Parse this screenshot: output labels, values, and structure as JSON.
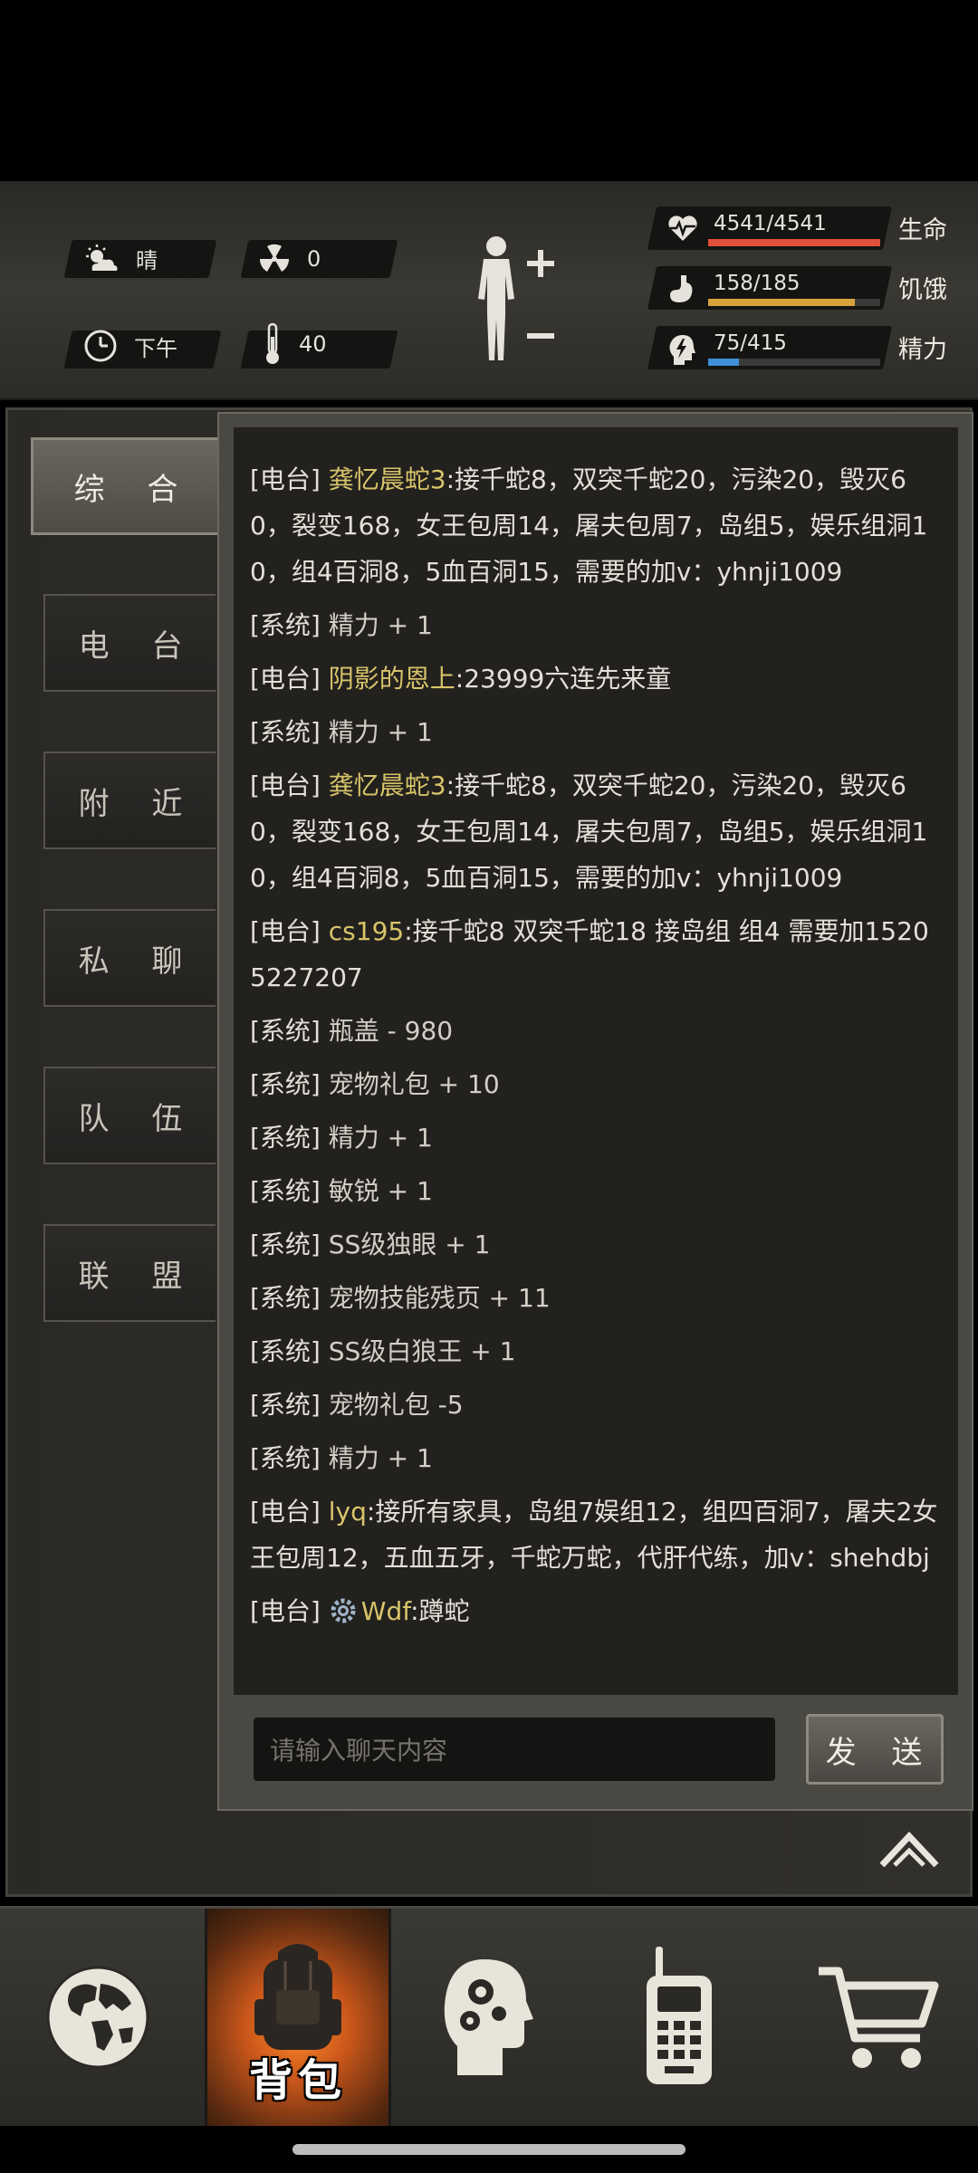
{
  "hud": {
    "weather": "晴",
    "radiation": "0",
    "time_of_day": "下午",
    "temperature": "40",
    "stats": [
      {
        "key": "health",
        "value": "4541/4541",
        "label": "生命",
        "fill": 1.0,
        "color": "#e0503a",
        "icon": "heart-pulse-icon"
      },
      {
        "key": "hunger",
        "value": "158/185",
        "label": "饥饿",
        "fill": 0.854,
        "color": "#d7a33a",
        "icon": "stomach-icon"
      },
      {
        "key": "energy",
        "value": "75/415",
        "label": "精力",
        "fill": 0.181,
        "color": "#3f8fd6",
        "icon": "head-bolt-icon"
      }
    ]
  },
  "tabs": [
    "综 合",
    "电 台",
    "附 近",
    "私 聊",
    "队 伍",
    "联 盟"
  ],
  "active_tab": 0,
  "messages": [
    {
      "channel": "[电台]",
      "sender": "龚忆晨蛇3",
      "text": ":接千蛇8，双突千蛇20，污染20，毁灭60，裂变168，女王包周14，屠夫包周7，岛组5，娱乐组洞10，组4百洞8，5血百洞15，需要的加v：yhnji1009"
    },
    {
      "channel": "[系统]",
      "sender": "",
      "text": "精力 + 1"
    },
    {
      "channel": "[电台]",
      "sender": "阴影的恩上",
      "text": ":23999六连先来童"
    },
    {
      "channel": "[系统]",
      "sender": "",
      "text": "精力 + 1"
    },
    {
      "channel": "[电台]",
      "sender": "龚忆晨蛇3",
      "text": ":接千蛇8，双突千蛇20，污染20，毁灭60，裂变168，女王包周14，屠夫包周7，岛组5，娱乐组洞10，组4百洞8，5血百洞15，需要的加v：yhnji1009"
    },
    {
      "channel": "[电台]",
      "sender": "cs195",
      "text": ":接千蛇8 双突千蛇18 接岛组 组4 需要加15205227207"
    },
    {
      "channel": "[系统]",
      "sender": "",
      "text": "瓶盖 - 980"
    },
    {
      "channel": "[系统]",
      "sender": "",
      "text": "宠物礼包 + 10"
    },
    {
      "channel": "[系统]",
      "sender": "",
      "text": "精力 + 1"
    },
    {
      "channel": "[系统]",
      "sender": "",
      "text": "敏锐 + 1"
    },
    {
      "channel": "[系统]",
      "sender": "",
      "text": "SS级独眼 + 1"
    },
    {
      "channel": "[系统]",
      "sender": "",
      "text": "宠物技能残页 + 11"
    },
    {
      "channel": "[系统]",
      "sender": "",
      "text": "SS级白狼王 + 1"
    },
    {
      "channel": "[系统]",
      "sender": "",
      "text": "宠物礼包 -5"
    },
    {
      "channel": "[系统]",
      "sender": "",
      "text": "精力 + 1"
    },
    {
      "channel": "[电台]",
      "sender": "lyq",
      "text": ":接所有家具，岛组7娱组12，组四百洞7，屠夫2女王包周12，五血五牙，千蛇万蛇，代肝代练，加v：shehdbj"
    },
    {
      "channel": "[电台]",
      "sender": "Wdf",
      "text": ":蹲蛇",
      "avatar": "gear-avatar-icon"
    }
  ],
  "chat_input": {
    "placeholder": "请输入聊天内容",
    "value": ""
  },
  "send_label": "发 送",
  "bottom_nav": [
    {
      "key": "world",
      "icon": "globe-icon",
      "label": ""
    },
    {
      "key": "backpack",
      "icon": "backpack-icon",
      "label": "背包",
      "active": true
    },
    {
      "key": "skills",
      "icon": "brain-gears-icon",
      "label": ""
    },
    {
      "key": "radio",
      "icon": "walkie-talkie-icon",
      "label": ""
    },
    {
      "key": "shop",
      "icon": "cart-icon",
      "label": ""
    }
  ]
}
